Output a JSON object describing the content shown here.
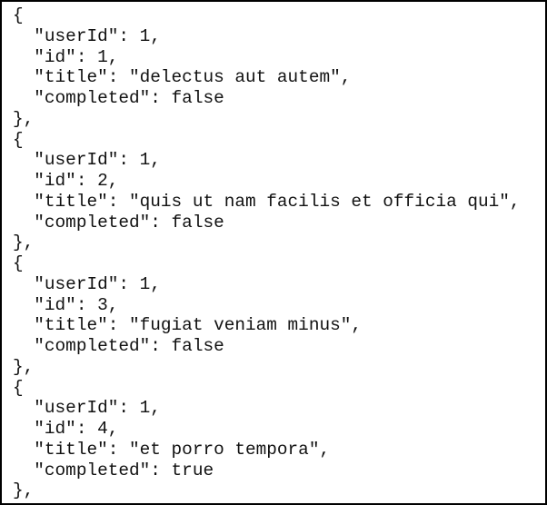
{
  "todos": [
    {
      "userId": 1,
      "id": 1,
      "title": "delectus aut autem",
      "completed": false
    },
    {
      "userId": 1,
      "id": 2,
      "title": "quis ut nam facilis et officia qui",
      "completed": false
    },
    {
      "userId": 1,
      "id": 3,
      "title": "fugiat veniam minus",
      "completed": false
    },
    {
      "userId": 1,
      "id": 4,
      "title": "et porro tempora",
      "completed": true
    }
  ],
  "lines": [
    "{",
    "  \"userId\": 1,",
    "  \"id\": 1,",
    "  \"title\": \"delectus aut autem\",",
    "  \"completed\": false",
    "},",
    "{",
    "  \"userId\": 1,",
    "  \"id\": 2,",
    "  \"title\": \"quis ut nam facilis et officia qui\",",
    "  \"completed\": false",
    "},",
    "{",
    "  \"userId\": 1,",
    "  \"id\": 3,",
    "  \"title\": \"fugiat veniam minus\",",
    "  \"completed\": false",
    "},",
    "{",
    "  \"userId\": 1,",
    "  \"id\": 4,",
    "  \"title\": \"et porro tempora\",",
    "  \"completed\": true",
    "},"
  ]
}
